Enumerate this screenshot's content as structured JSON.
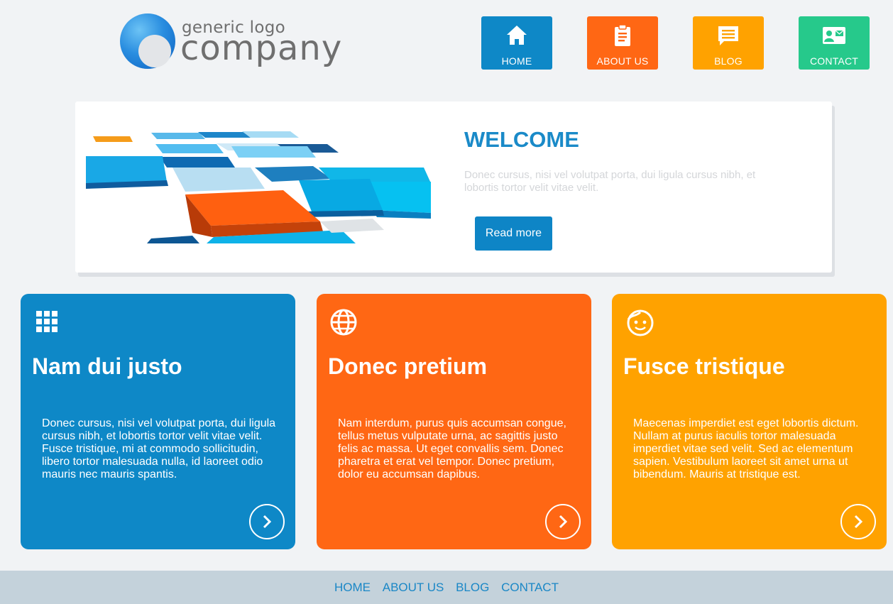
{
  "header": {
    "logo": {
      "small_text": "generic logo",
      "big_text": "company"
    },
    "nav": [
      {
        "label": "HOME",
        "icon": "home-icon",
        "color": "#0e88c7"
      },
      {
        "label": "ABOUT US",
        "icon": "clipboard-icon",
        "color": "#ff6714"
      },
      {
        "label": "BLOG",
        "icon": "comment-icon",
        "color": "#ffa200"
      },
      {
        "label": "CONTACT",
        "icon": "contact-card-icon",
        "color": "#26c98b"
      }
    ]
  },
  "hero": {
    "title": "WELCOME",
    "text": "Donec cursus, nisi vel volutpat porta, dui ligula cursus nibh, et lobortis tortor velit vitae velit.",
    "button_label": "Read more"
  },
  "cards": [
    {
      "icon": "grid-icon",
      "title": "Nam dui justo",
      "text": "Donec cursus, nisi vel volutpat porta, dui ligula cursus nibh, et lobortis tortor velit vitae velit. Fusce tristique, mi at commodo sollicitudin, libero tortor malesuada nulla, id laoreet odio mauris nec mauris spantis.",
      "color": "#0e88c7"
    },
    {
      "icon": "globe-icon",
      "title": "Donec pretium",
      "text": "Nam interdum, purus quis accumsan congue, tellus metus vulputate urna, ac sagittis justo felis ac massa. Ut eget convallis sem. Donec pharetra et erat vel tempor. Donec pretium, dolor eu accumsan dapibus.",
      "color": "#ff6714"
    },
    {
      "icon": "smiley-face-icon",
      "title": "Fusce tristique",
      "text": "Maecenas imperdiet est eget lobortis dictum. Nullam at purus iaculis tortor malesuada imperdiet vitae sed velit. Sed ac elementum sapien. Vestibulum laoreet sit amet urna ut bibendum. Mauris at tristique est.",
      "color": "#ffa200"
    }
  ],
  "footer": {
    "links": [
      "HOME",
      "ABOUT US",
      "BLOG",
      "CONTACT"
    ]
  }
}
